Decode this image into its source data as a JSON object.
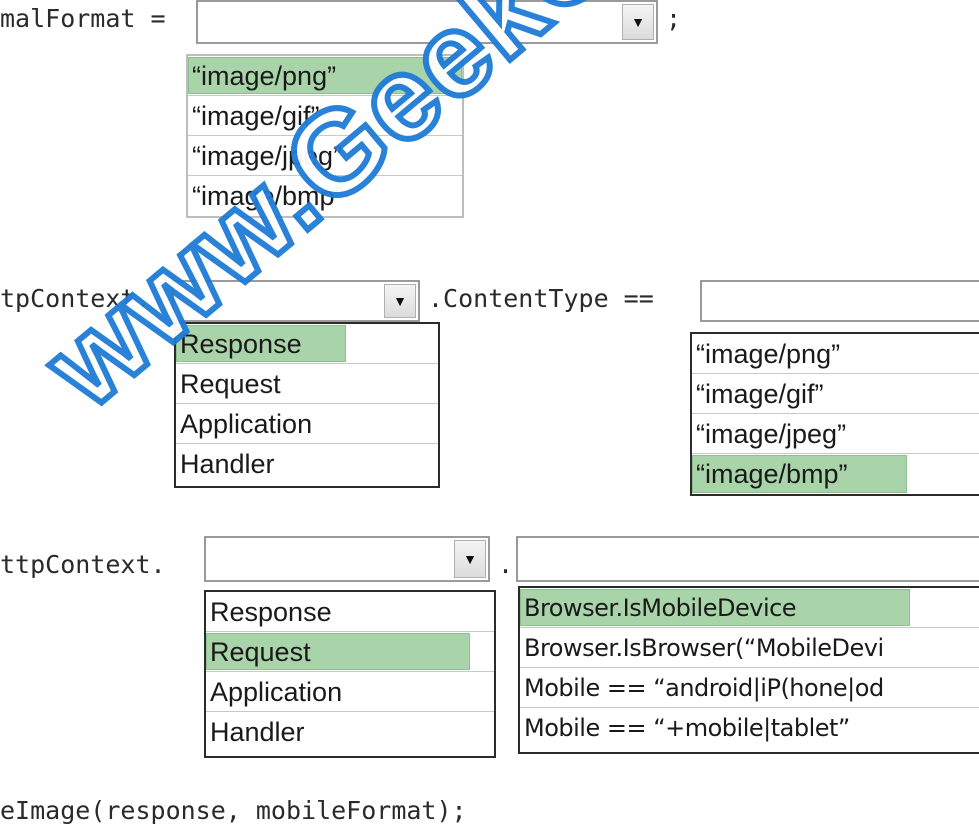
{
  "code": {
    "line1_prefix": "malFormat =",
    "line1_suffix": ";",
    "line2_prefix": "tpContext.",
    "line2_middle": ".ContentType ==",
    "line3_prefix": "ttpContext.",
    "line3_middle": ".",
    "line4": "eImage(response, mobileFormat);"
  },
  "dropdown1": {
    "selected": "",
    "options": [
      "“image/png”",
      "“image/gif”",
      "“image/jpeg”",
      "“image/bmp”"
    ],
    "highlighted_index": 0
  },
  "dropdown2": {
    "selected": "",
    "options": [
      "Response",
      "Request",
      "Application",
      "Handler"
    ],
    "highlighted_index": 0
  },
  "dropdown3": {
    "selected": "",
    "options": [
      "“image/png”",
      "“image/gif”",
      "“image/jpeg”",
      "“image/bmp”"
    ],
    "highlighted_index": 3
  },
  "dropdown4": {
    "selected": "",
    "options": [
      "Response",
      "Request",
      "Application",
      "Handler"
    ],
    "highlighted_index": 1
  },
  "dropdown5": {
    "selected": "",
    "options": [
      "Browser.IsMobileDevice",
      "Browser.IsBrowser(“MobileDevi",
      "Mobile == “android|iP(hone|od",
      "Mobile == “+mobile|tablet”"
    ],
    "highlighted_index": 0
  },
  "watermark": "www.GeekCert.com",
  "colors": {
    "highlight": "#a9d3a9",
    "watermark_stroke": "#1e7bd6"
  },
  "icons": {
    "dropdown_arrow": "chevron-down-icon"
  }
}
